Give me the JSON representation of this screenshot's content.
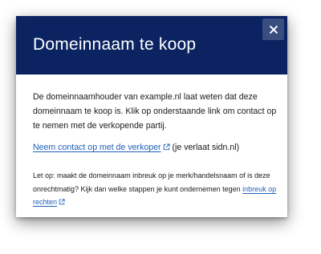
{
  "dialog": {
    "title": "Domeinnaam te koop",
    "close_icon": "close-icon",
    "body_text": "De domeinnaamhouder van example.nl laat weten dat deze domeinnaam te koop is. Klik op onderstaande link om contact op te nemen met de verkopende partij.",
    "contact_link": "Neem contact op met de verkoper",
    "contact_suffix": " (je verlaat sidn.nl)",
    "note_text": "Let op: maakt de domeinnaam inbreuk op je merk/handelsnaam of is deze onrechtmatig? Kijk dan welke stappen je kunt ondernemen tegen ",
    "note_link": "inbreuk op rechten",
    "external_link_icon": "external-link-icon",
    "colors": {
      "header_bg": "#0b2360",
      "close_bg": "#3a4d7f",
      "link": "#1d5fb8",
      "text": "#1a1a1a"
    }
  }
}
